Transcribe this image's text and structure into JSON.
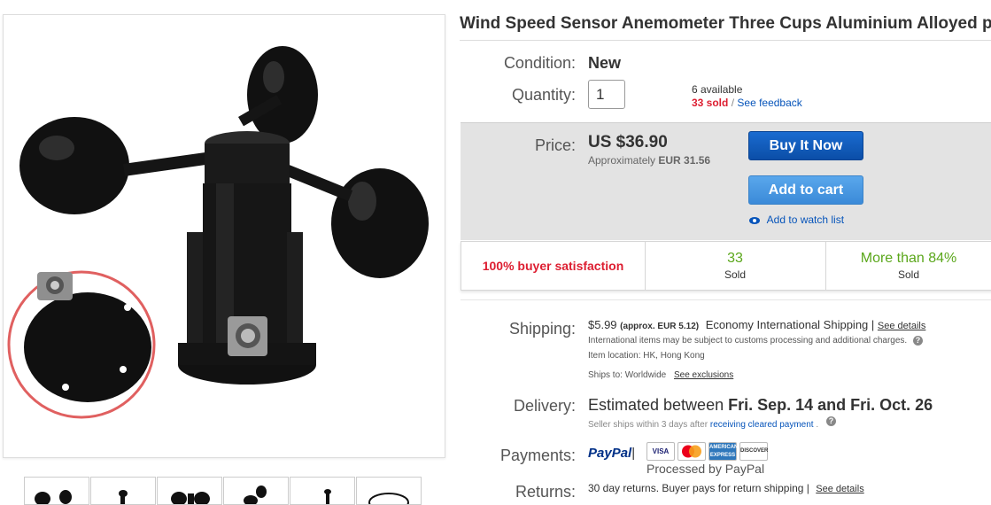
{
  "listing": {
    "title": "Wind Speed Sensor Anemometer Three Cups Aluminium Alloyed pulse"
  },
  "condition": {
    "label": "Condition:",
    "value": "New"
  },
  "quantity": {
    "label": "Quantity:",
    "value": "1",
    "available": "6 available",
    "sold": "33 sold",
    "separator": "/",
    "feedback_link": "See feedback"
  },
  "price": {
    "label": "Price:",
    "value": "US $36.90",
    "approx_prefix": "Approximately",
    "approx_value": "EUR 31.56",
    "buy_now": "Buy It Now",
    "add_to_cart": "Add to cart",
    "watch_list": "Add to watch list"
  },
  "stats": {
    "satisfaction": "100% buyer satisfaction",
    "sold_count": "33",
    "sold_label": "Sold",
    "more_than": "More than 84%",
    "more_label": "Sold"
  },
  "shipping": {
    "label": "Shipping:",
    "price": "$5.99",
    "approx": "(approx. EUR 5.12)",
    "method": "Economy International Shipping |",
    "details_link": "See details",
    "customs_note": "International items may be subject to customs processing and additional charges.",
    "item_location": "Item location:  HK, Hong Kong",
    "ships_to": "Ships to:  Worldwide",
    "exclusions_link": "See exclusions"
  },
  "delivery": {
    "label": "Delivery:",
    "prefix": "Estimated between",
    "dates": "Fri. Sep. 14 and Fri. Oct. 26",
    "note_prefix": "Seller ships within 3 days after",
    "note_link": "receiving cleared payment",
    "note_suffix": "."
  },
  "payments": {
    "label": "Payments:",
    "paypal": "PayPal",
    "paypal_sep": "|",
    "cards": [
      "VISA",
      "MasterCard",
      "AMERICAN EXPRESS",
      "DISCOVER"
    ],
    "processed": "Processed by PayPal"
  },
  "returns": {
    "label": "Returns:",
    "text": "30 day returns. Buyer pays for return shipping |",
    "details_link": "See details"
  },
  "colors": {
    "sold_red": "#dd1e31",
    "link_blue": "#0654ba",
    "green": "#5ba71b",
    "buy_now_blue": "#0b4ea7",
    "add_cart_blue": "#3b8ad8"
  },
  "icons": [
    "eye-icon",
    "question-icon"
  ]
}
